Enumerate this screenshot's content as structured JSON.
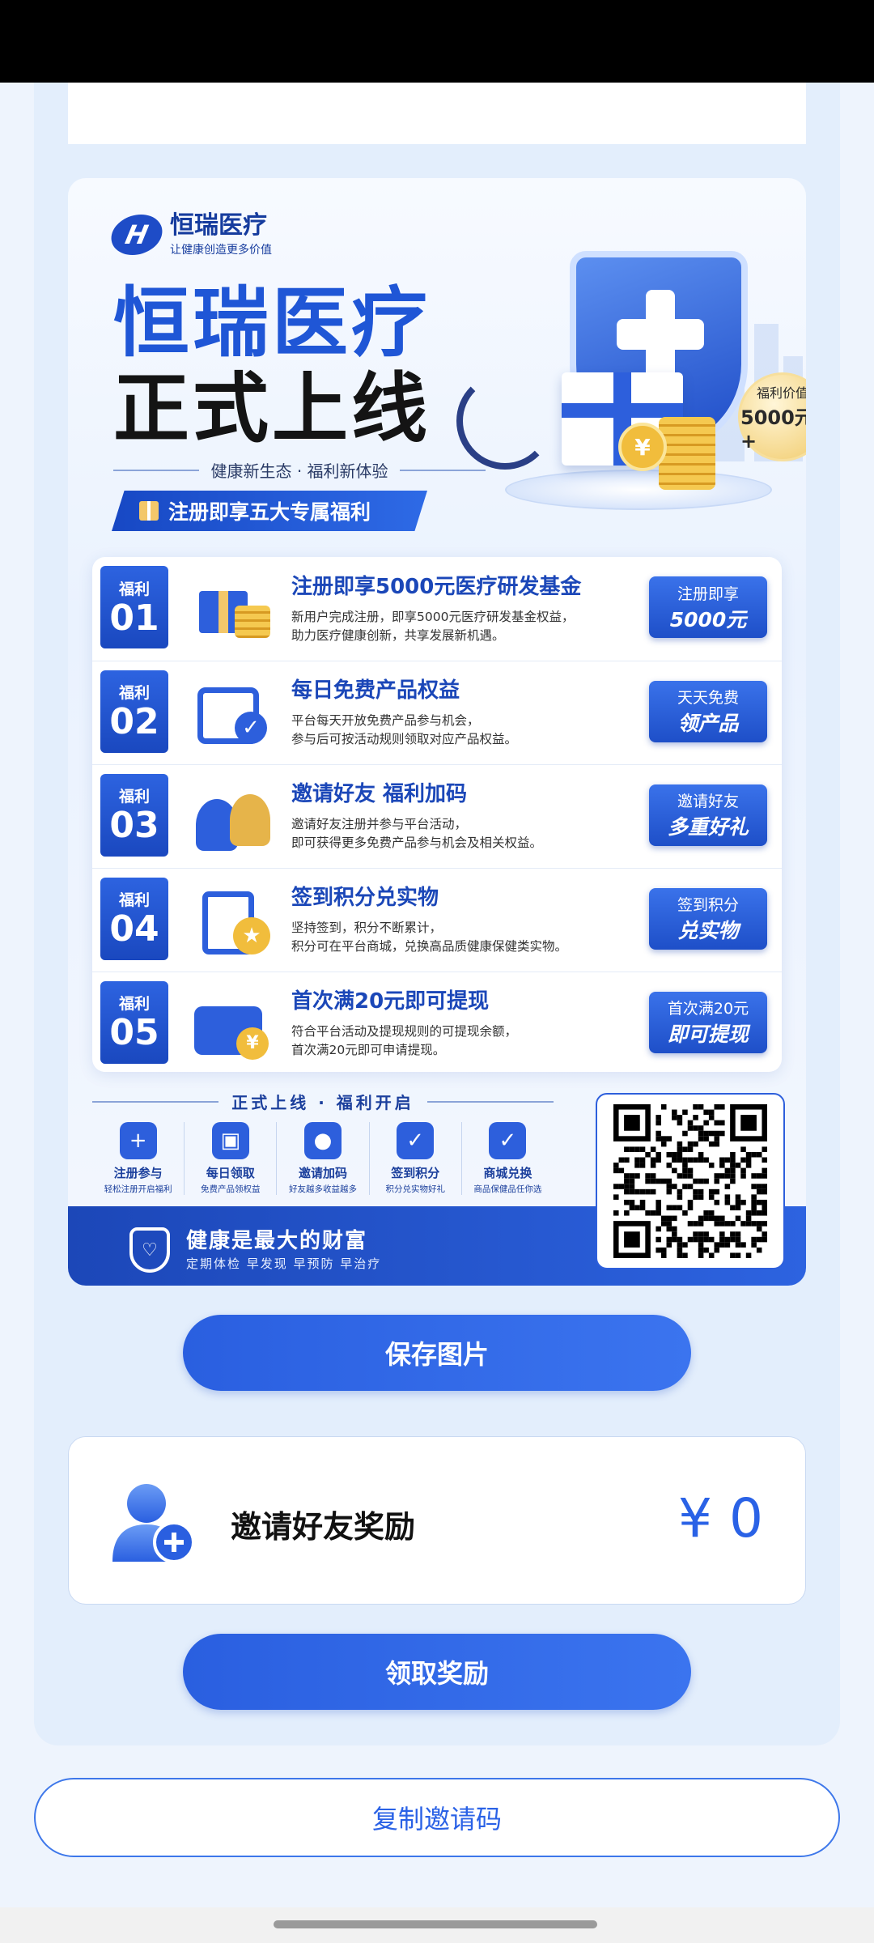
{
  "poster": {
    "logo_mark": "H",
    "logo_name": "恒瑞医疗",
    "logo_slogan": "让健康创造更多价值",
    "headline_1": "恒瑞医疗",
    "headline_2": "正式上线",
    "subline": "健康新生态 · 福利新体验",
    "banner": "注册即享五大专属福利",
    "badge_top": "福利价值",
    "badge_value": "5000元+",
    "coin_symbol": "¥",
    "benefits": [
      {
        "tag_label": "福利",
        "tag_no": "01",
        "title": "注册即享5000元医疗研发基金",
        "desc_1": "新用户完成注册，即享5000元医疗研发基金权益，",
        "desc_2": "助力医疗健康创新，共享发展新机遇。",
        "btn_a": "注册即享",
        "btn_b": "5000元"
      },
      {
        "tag_label": "福利",
        "tag_no": "02",
        "title": "每日免费产品权益",
        "desc_1": "平台每天开放免费产品参与机会，",
        "desc_2": "参与后可按活动规则领取对应产品权益。",
        "btn_a": "天天免费",
        "btn_b": "领产品"
      },
      {
        "tag_label": "福利",
        "tag_no": "03",
        "title": "邀请好友 福利加码",
        "desc_1": "邀请好友注册并参与平台活动，",
        "desc_2": "即可获得更多免费产品参与机会及相关权益。",
        "btn_a": "邀请好友",
        "btn_b": "多重好礼"
      },
      {
        "tag_label": "福利",
        "tag_no": "04",
        "title": "签到积分兑实物",
        "desc_1": "坚持签到，积分不断累计，",
        "desc_2": "积分可在平台商城，兑换高品质健康保健类实物。",
        "btn_a": "签到积分",
        "btn_b": "兑实物"
      },
      {
        "tag_label": "福利",
        "tag_no": "05",
        "title": "首次满20元即可提现",
        "desc_1": "符合平台活动及提现规则的可提现余额，",
        "desc_2": "首次满20元即可申请提现。",
        "btn_a": "首次满20元",
        "btn_b": "即可提现"
      }
    ],
    "launch_line": "正式上线 · 福利开启",
    "mini_features": [
      {
        "icon": "user-plus-icon",
        "glyph": "+",
        "l1": "注册参与",
        "l2": "轻松注册开启福利"
      },
      {
        "icon": "gift-icon",
        "glyph": "▣",
        "l1": "每日领取",
        "l2": "免费产品领权益"
      },
      {
        "icon": "users-icon",
        "glyph": "●",
        "l1": "邀请加码",
        "l2": "好友越多收益越多"
      },
      {
        "icon": "calendar-check-icon",
        "glyph": "✓",
        "l1": "签到积分",
        "l2": "积分兑实物好礼"
      },
      {
        "icon": "shopping-bag-icon",
        "glyph": "✓",
        "l1": "商城兑换",
        "l2": "商品保健品任你选"
      }
    ],
    "footer_title": "健康是最大的财富",
    "footer_sub": "定期体检 早发现 早预防 早治疗",
    "shield_glyph": "♡"
  },
  "actions": {
    "save_image": "保存图片",
    "claim_reward": "领取奖励",
    "copy_code": "复制邀请码"
  },
  "reward": {
    "label": "邀请好友奖励",
    "amount": "¥ 0"
  },
  "colors": {
    "accent": "#2a62e6",
    "brand_dark": "#1b47b8",
    "gold": "#f1bd3c"
  }
}
